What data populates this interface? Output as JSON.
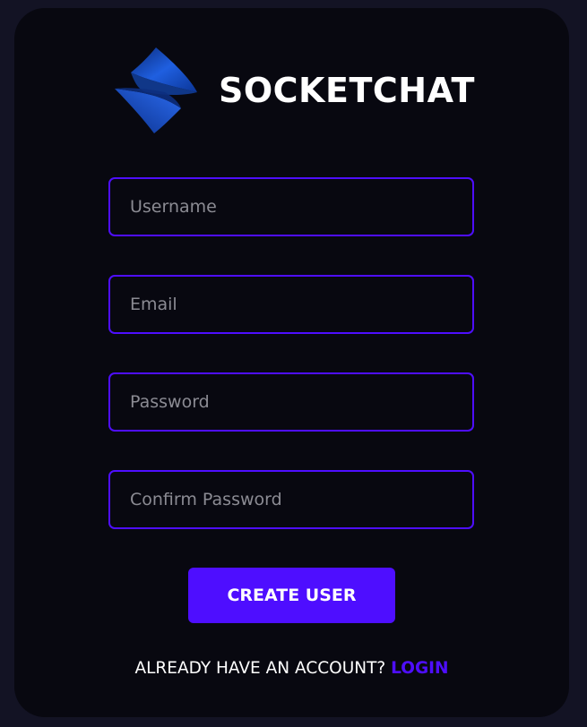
{
  "brand": {
    "name": "SOCKETCHAT",
    "logo_icon": "socketchat-logo-icon"
  },
  "form": {
    "username_placeholder": "Username",
    "email_placeholder": "Email",
    "password_placeholder": "Password",
    "confirm_password_placeholder": "Confirm Password",
    "submit_label": "CREATE USER"
  },
  "footer": {
    "prompt": "ALREADY HAVE AN ACCOUNT?",
    "link_label": "LOGIN"
  },
  "colors": {
    "page_background": "#131324",
    "card_background": "#080810",
    "accent": "#4e0eff",
    "text": "#ffffff",
    "placeholder": "#8b8b93"
  }
}
